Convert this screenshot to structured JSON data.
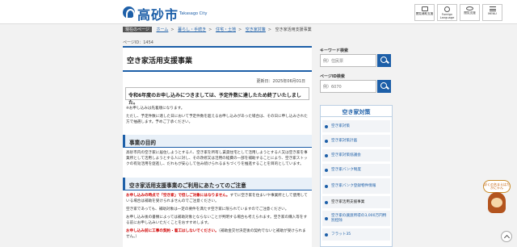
{
  "header": {
    "site_name": "高砂市",
    "site_name_en": "Takasago City",
    "buttons": [
      {
        "label": "閲覧補助支援",
        "icon": "reader-icon"
      },
      {
        "label": "Foreign Language",
        "icon": "globe-icon"
      },
      {
        "label": "閲覧支援",
        "icon": "eye-icon"
      },
      {
        "label": "MENU",
        "icon": "menu-icon"
      }
    ]
  },
  "breadcrumb": {
    "lead": "現在のページ",
    "items": [
      "ホーム",
      "暮らし・手続き",
      "住宅・土地",
      "空き家対策",
      "空き家活用支援事業"
    ]
  },
  "page_id": "ページID：1454",
  "main": {
    "title": "空き家活用支援事業",
    "updated": "更新日：2025年06月01日",
    "notice": "令和6年度のお申し込みにつきましては、予定件数に達したため終了いたしました。",
    "note1": "※お申し込みは先着順になります。",
    "note2": "ただし、予定件数に達した日において予定件数を超えるお申し込みがあった場合は、その日に申し込みされた方で抽選します。予めご了承ください。",
    "section1_heading": "事業の目的",
    "section1_text": "高砂市内の空き家に居住しようとする人、空き家を所有し賃貸住宅として活用しようとする人又は空き家を事業所として活用しようとする人に対し、その改修又は活用の経費の一部を補助することにより、空き家ストックの有効活用を促進し、だれもが安心して住み続けられるまちづくりを推進することを目的としています。",
    "section2_heading": "空き家活用支援事業のご利用にあたってのご注意",
    "caution1_red": "お申し込みの時点で「空き家」で但しご対象にはなりません。",
    "caution1_rest": "すでに空き家を住まいや事業所として使用している場合は補助を受けられませんのでご注意ください。",
    "caution2": "空き家であっても、補助対象は一定の要件を満たす空き家に限られていますのでご注意ください。",
    "caution3": "お申し込み後の書類によっては補助対象とならないことが判明する場合も考えられます。空き家の購入等をする前にお申し込みいただくことをおすすめします。",
    "caution4_red": "お申し込み前に工事の契約・着工はしないでください。",
    "caution4_rest": "（補助金交付決定後の契約でないと補助が受けられません。）"
  },
  "side": {
    "keyword_label": "キーワード検索",
    "keyword_placeholder": "例）住民票",
    "pageid_label": "ページID検索",
    "pageid_placeholder": "例）6070",
    "related_heading": "空き家対策",
    "related_items": [
      "空き家対策",
      "空き家対策計画",
      "空き家対策協議会",
      "空き家バンク制度",
      "空き家バンク登録物件情報",
      "空き家活用支援事業",
      "空き家の譲渡所得の3,000万円特別控除",
      "フラット35"
    ],
    "active_index": 5
  },
  "mascot": {
    "bubble": "ぼくの名まえはたかにゃん"
  }
}
